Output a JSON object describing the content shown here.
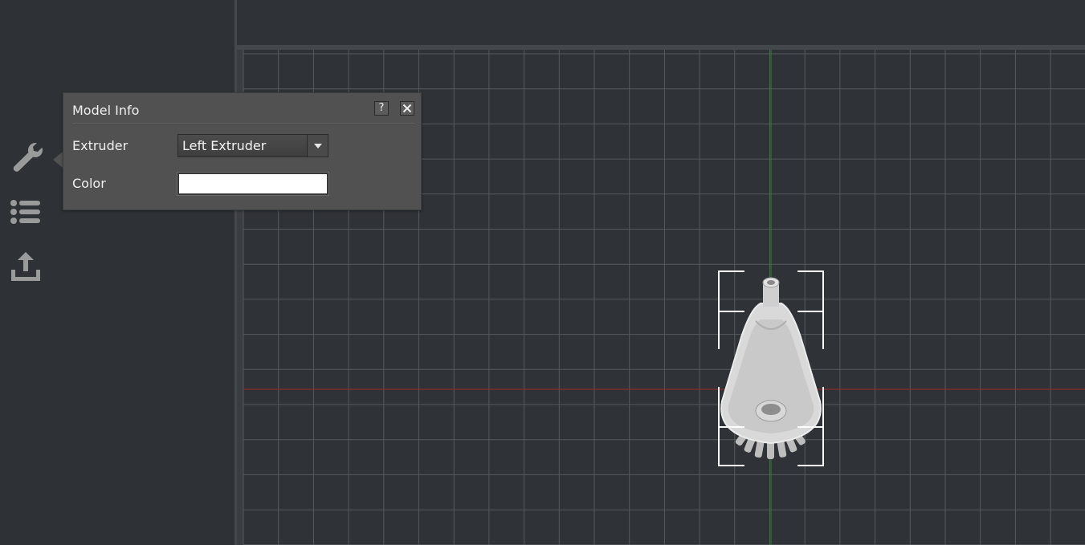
{
  "panel": {
    "title": "Model Info",
    "help_label": "?",
    "close_label": "✕",
    "extruder_label": "Extruder",
    "extruder_value": "Left Extruder",
    "color_label": "Color",
    "color_value": "#ffffff"
  },
  "sidebar": {
    "items": [
      {
        "name": "wrench-icon"
      },
      {
        "name": "list-icon"
      },
      {
        "name": "export-icon"
      }
    ]
  },
  "colors": {
    "background": "#2e3135",
    "panel": "#515151",
    "grid": "#5a5e63",
    "x_axis": "#a02828",
    "y_axis": "#1f8a2a",
    "model": "#d4d4d4"
  }
}
